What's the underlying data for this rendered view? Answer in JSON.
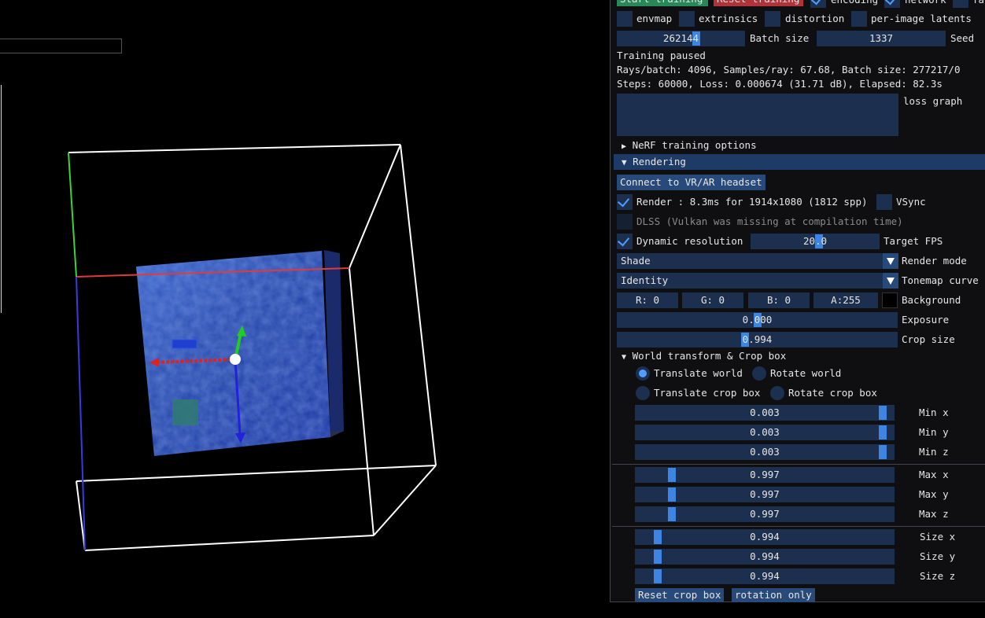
{
  "top_buttons": {
    "start_training": "Start training",
    "reset_training": "Reset training",
    "encoding": "encoding",
    "network": "network",
    "truncated": "fa"
  },
  "train_options": {
    "envmap": "envmap",
    "extrinsics": "extrinsics",
    "distortion": "distortion",
    "per_image_latents": "per-image latents"
  },
  "batch": {
    "batch_size_value": "262144",
    "batch_size_label": "Batch size",
    "seed_value": "1337",
    "seed_label": "Seed"
  },
  "status": {
    "line1": "Training paused",
    "line2": "Rays/batch: 4096, Samples/ray: 67.68, Batch size: 277217/0",
    "line3": "Steps: 60000, Loss: 0.000674 (31.71 dB), Elapsed: 82.3s",
    "loss_graph_label": "loss graph"
  },
  "sections": {
    "nerf_training_options": "NeRF training options",
    "rendering": "Rendering",
    "world_transform": "World transform & Crop box"
  },
  "rendering": {
    "connect_vr": "Connect to VR/AR headset",
    "render_info": "Render : 8.3ms for 1914x1080 (1812 spp)",
    "vsync": "VSync",
    "dlss": "DLSS (Vulkan was missing at compilation time)",
    "dynamic_resolution": "Dynamic resolution",
    "target_fps_value": "20.0",
    "target_fps_label": "Target FPS",
    "render_mode_value": "Shade",
    "render_mode_label": "Render mode",
    "tonemap_value": "Identity",
    "tonemap_label": "Tonemap curve",
    "r": "R:  0",
    "g": "G:  0",
    "b": "B:  0",
    "a": "A:255",
    "background_label": "Background",
    "background_color": "#000000",
    "exposure_value": "0.000",
    "exposure_label": "Exposure",
    "crop_size_value": "0.994",
    "crop_size_label": "Crop size"
  },
  "transform": {
    "translate_world": "Translate world",
    "rotate_world": "Rotate world",
    "translate_crop_box": "Translate crop box",
    "rotate_crop_box": "Rotate crop box",
    "sliders": [
      {
        "value": "0.003",
        "label": "Min x",
        "level": 0.003
      },
      {
        "value": "0.003",
        "label": "Min y",
        "level": 0.003
      },
      {
        "value": "0.003",
        "label": "Min z",
        "level": 0.003
      },
      {
        "value": "0.997",
        "label": "Max x",
        "level": 0.997
      },
      {
        "value": "0.997",
        "label": "Max y",
        "level": 0.997
      },
      {
        "value": "0.997",
        "label": "Max z",
        "level": 0.997
      },
      {
        "value": "0.994",
        "label": "Size x",
        "level": 0.994
      },
      {
        "value": "0.994",
        "label": "Size y",
        "level": 0.994
      },
      {
        "value": "0.994",
        "label": "Size z",
        "level": 0.994
      }
    ],
    "reset_crop_box": "Reset crop box",
    "rotation_only": "rotation only"
  },
  "colors": {
    "panel_bg": "#0f0f12",
    "frame_bg": "#1d2f4e",
    "button": "#284a7a",
    "accent": "#4f9eff",
    "start_button": "#29875a",
    "reset_button": "#b0323a"
  }
}
